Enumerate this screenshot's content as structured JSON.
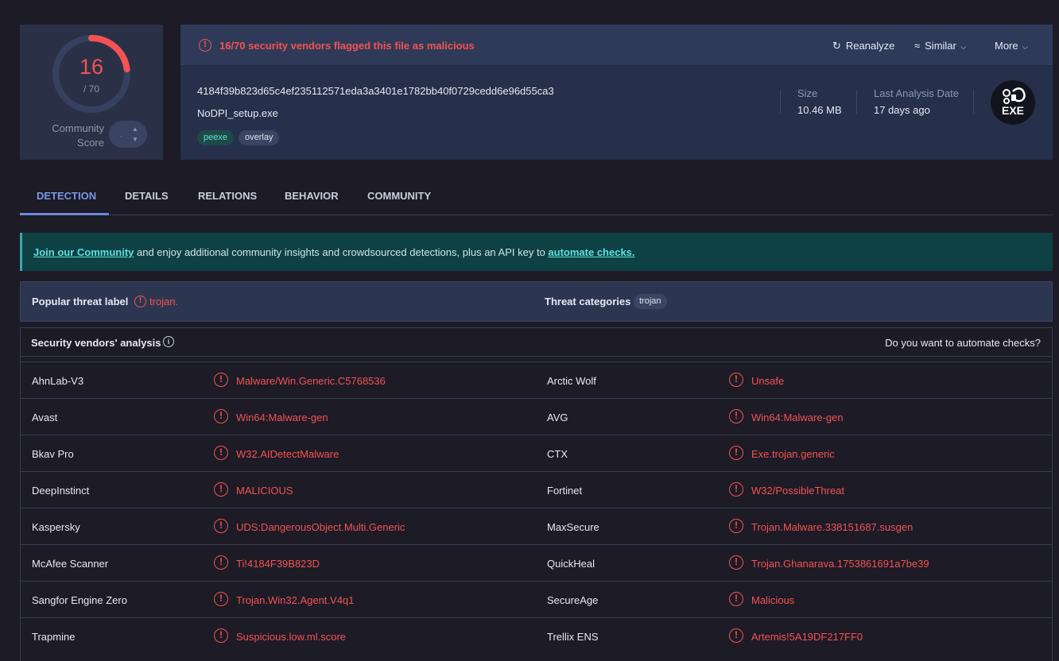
{
  "score": {
    "detections": "16",
    "total": "/ 70",
    "fraction": 0.2286,
    "community_label": "Community Score",
    "vote_value": "·"
  },
  "header": {
    "flag_text": "16/70 security vendors flagged this file as malicious",
    "reanalyze": "Reanalyze",
    "similar": "Similar",
    "more": "More"
  },
  "file": {
    "hash": "4184f39b823d65c4ef235112571eda3a3401e1782bb40f0729cedd6e96d55ca3",
    "name": "NoDPI_setup.exe",
    "tags": [
      "peexe",
      "overlay"
    ],
    "size_label": "Size",
    "size_value": "10.46 MB",
    "date_label": "Last Analysis Date",
    "date_value": "17 days ago",
    "type_badge": "EXE"
  },
  "tabs": [
    "DETECTION",
    "DETAILS",
    "RELATIONS",
    "BEHAVIOR",
    "COMMUNITY"
  ],
  "banner": {
    "link1": "Join our Community",
    "middle": " and enjoy additional community insights and crowdsourced detections, plus an API key to ",
    "link2": "automate checks."
  },
  "threat": {
    "label": "Popular threat label",
    "value": "trojan.",
    "categories_label": "Threat categories",
    "category": "trojan"
  },
  "analysis": {
    "title": "Security vendors' analysis",
    "automate_question": "Do you want to automate checks?",
    "rows": [
      {
        "v1": "AhnLab-V3",
        "r1": "Malware/Win.Generic.C5768536",
        "v2": "Arctic Wolf",
        "r2": "Unsafe"
      },
      {
        "v1": "Avast",
        "r1": "Win64:Malware-gen",
        "v2": "AVG",
        "r2": "Win64:Malware-gen"
      },
      {
        "v1": "Bkav Pro",
        "r1": "W32.AIDetectMalware",
        "v2": "CTX",
        "r2": "Exe.trojan.generic"
      },
      {
        "v1": "DeepInstinct",
        "r1": "MALICIOUS",
        "v2": "Fortinet",
        "r2": "W32/PossibleThreat"
      },
      {
        "v1": "Kaspersky",
        "r1": "UDS:DangerousObject.Multi.Generic",
        "v2": "MaxSecure",
        "r2": "Trojan.Malware.338151687.susgen"
      },
      {
        "v1": "McAfee Scanner",
        "r1": "Ti!4184F39B823D",
        "v2": "QuickHeal",
        "r2": "Trojan.Ghanarava.1753861691a7be39"
      },
      {
        "v1": "Sangfor Engine Zero",
        "r1": "Trojan.Win32.Agent.V4q1",
        "v2": "SecureAge",
        "r2": "Malicious"
      },
      {
        "v1": "Trapmine",
        "r1": "Suspicious.low.ml.score",
        "v2": "Trellix ENS",
        "r2": "Artemis!5A19DF217FF0"
      }
    ]
  },
  "colors": {
    "malicious": "#f55252",
    "accent": "#6c89db",
    "banner_bg": "#0e4143"
  }
}
